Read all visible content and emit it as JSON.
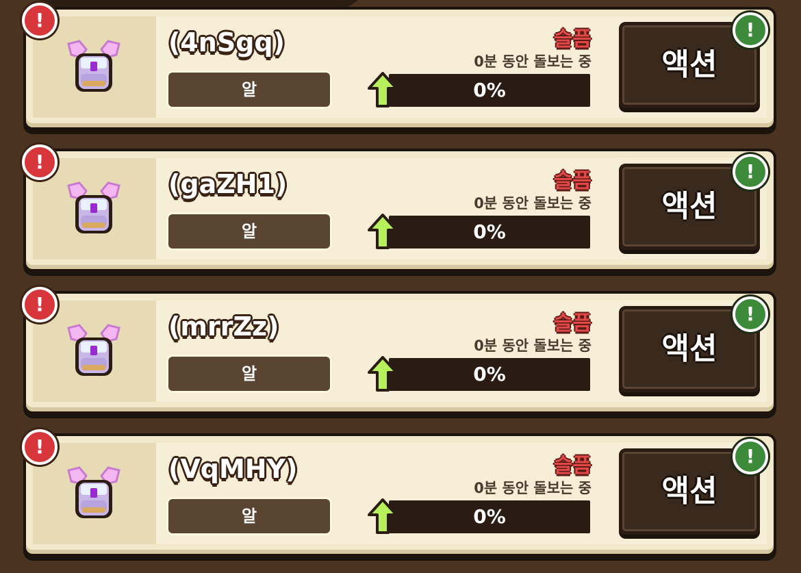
{
  "pets": [
    {
      "name": "(4nSgq)",
      "type": "알",
      "status": "슬픔",
      "duration": "0분 동안 돌보는 중",
      "progress": "0%",
      "progress_value": 0,
      "action": "액션"
    },
    {
      "name": "(gaZH1)",
      "type": "알",
      "status": "슬픔",
      "duration": "0분 동안 돌보는 중",
      "progress": "0%",
      "progress_value": 0,
      "action": "액션"
    },
    {
      "name": "(mrrZz)",
      "type": "알",
      "status": "슬픔",
      "duration": "0분 동안 돌보는 중",
      "progress": "0%",
      "progress_value": 0,
      "action": "액션"
    },
    {
      "name": "(VqMHY)",
      "type": "알",
      "status": "슬픔",
      "duration": "0분 동안 돌보는 중",
      "progress": "0%",
      "progress_value": 0,
      "action": "액션"
    }
  ],
  "icons": {
    "alert": "alert-icon",
    "ok": "ok-icon",
    "pet": "pet-egg-icon",
    "arrow": "up-arrow-icon"
  },
  "colors": {
    "status": "#e24848",
    "progress": "#7acb3a",
    "alert": "#d7373a",
    "ok": "#3c8a3a"
  }
}
